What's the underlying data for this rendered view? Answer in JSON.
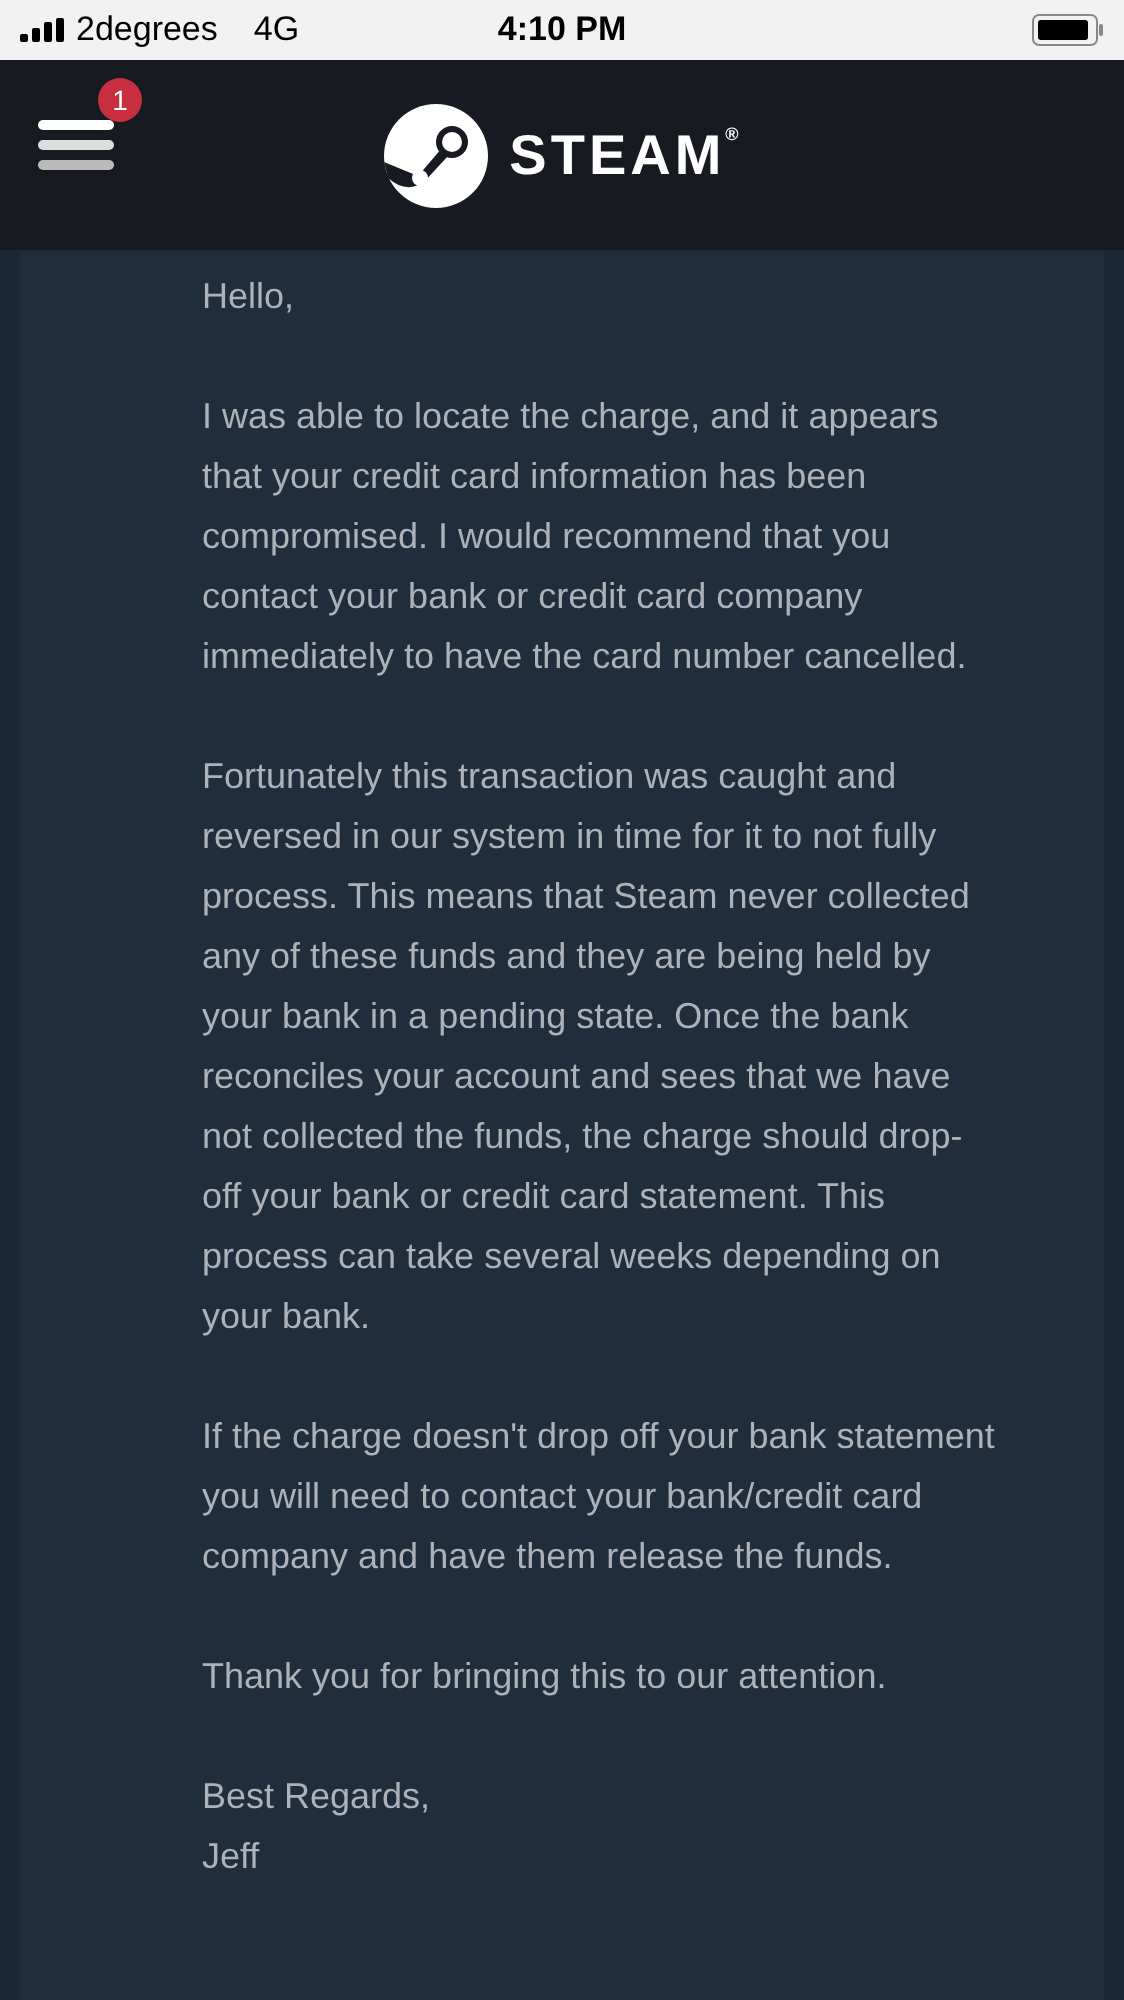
{
  "status_bar": {
    "carrier": "2degrees",
    "network": "4G",
    "time": "4:10 PM"
  },
  "header": {
    "menu_badge": "1",
    "logo_text": "STEAM",
    "logo_mark": "®"
  },
  "message": {
    "paragraphs": [
      "Hello,",
      "I was able to locate the charge, and it appears that your credit card information has been compromised. I would recommend that you contact your bank or credit card company immediately to have the card number cancelled.",
      "Fortunately this transaction was caught and reversed in our system in time for it to not fully process. This means that Steam never collected any of these funds and they are being held by your bank in a pending state. Once the bank reconciles your account and sees that we have not collected the funds, the charge should drop-off your bank or credit card statement. This process can take several weeks depending on your bank.",
      "If the charge doesn't drop off your bank statement you will need to contact your bank/credit card company and have them release the funds.",
      "Thank you for bringing this to our attention."
    ],
    "signoff": "Best Regards,",
    "signature": "Jeff"
  }
}
